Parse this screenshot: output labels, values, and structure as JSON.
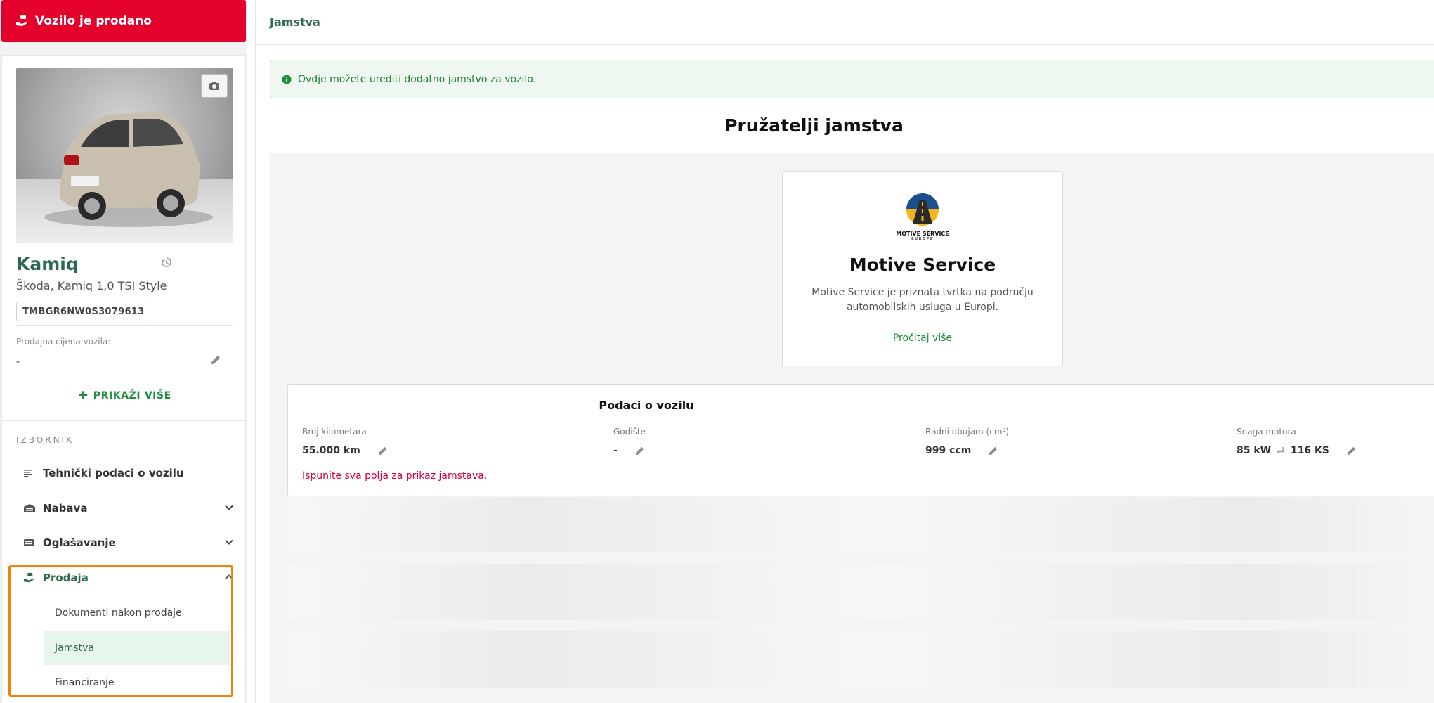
{
  "sidebar": {
    "sold_button_label": "Vozilo je prodano",
    "car": {
      "title": "Kamiq",
      "subtitle": "Škoda, Kamiq 1,0 TSI Style",
      "vin": "TMBGR6NW0S3079613",
      "price_label": "Prodajna cijena vozila:",
      "price_value": "-",
      "show_more_label": "PRIKAŽI VIŠE"
    },
    "menu": {
      "heading": "IZBORNIK",
      "items": [
        {
          "label": "Tehnički podaci o vozilu",
          "icon": "list-icon"
        },
        {
          "label": "Nabava",
          "icon": "garage-icon"
        },
        {
          "label": "Oglašavanje",
          "icon": "card-icon"
        },
        {
          "label": "Prodaja",
          "icon": "hand-car-icon"
        }
      ],
      "prodaja_subitems": [
        {
          "label": "Dokumenti nakon prodaje"
        },
        {
          "label": "Jamstva"
        },
        {
          "label": "Financiranje"
        }
      ]
    }
  },
  "header": {
    "title": "Jamstva"
  },
  "alert": {
    "text": "Ovdje možete urediti dodatno jamstvo za vozilo."
  },
  "section": {
    "title": "Pružatelji jamstva"
  },
  "provider": {
    "logo_text": "MOTIVE SERVICE",
    "logo_subtext": "EUROPE",
    "name": "Motive Service",
    "description": "Motive Service je priznata tvrtka na području automobilskih usluga u Europi.",
    "read_more_label": "Pročitaj više"
  },
  "vehicle": {
    "title": "Podaci o vozilu",
    "fields": [
      {
        "label": "Broj kilometara",
        "value": "55.000 km"
      },
      {
        "label": "Godište",
        "value": "-"
      },
      {
        "label": "Radni obujam (cm³)",
        "value": "999 ccm"
      },
      {
        "label": "Snaga motora",
        "value_kw": "85 kW",
        "swap": "⇄",
        "value_ks": "116 KS"
      }
    ],
    "error": "Ispunite sva polja za prikaz jamstava."
  },
  "colors": {
    "brand_red": "#e4022d",
    "primary_green": "#2d6a4f",
    "link_green": "#1e8e3e",
    "highlight_orange": "#f0820f",
    "error_red": "#d6003a"
  }
}
